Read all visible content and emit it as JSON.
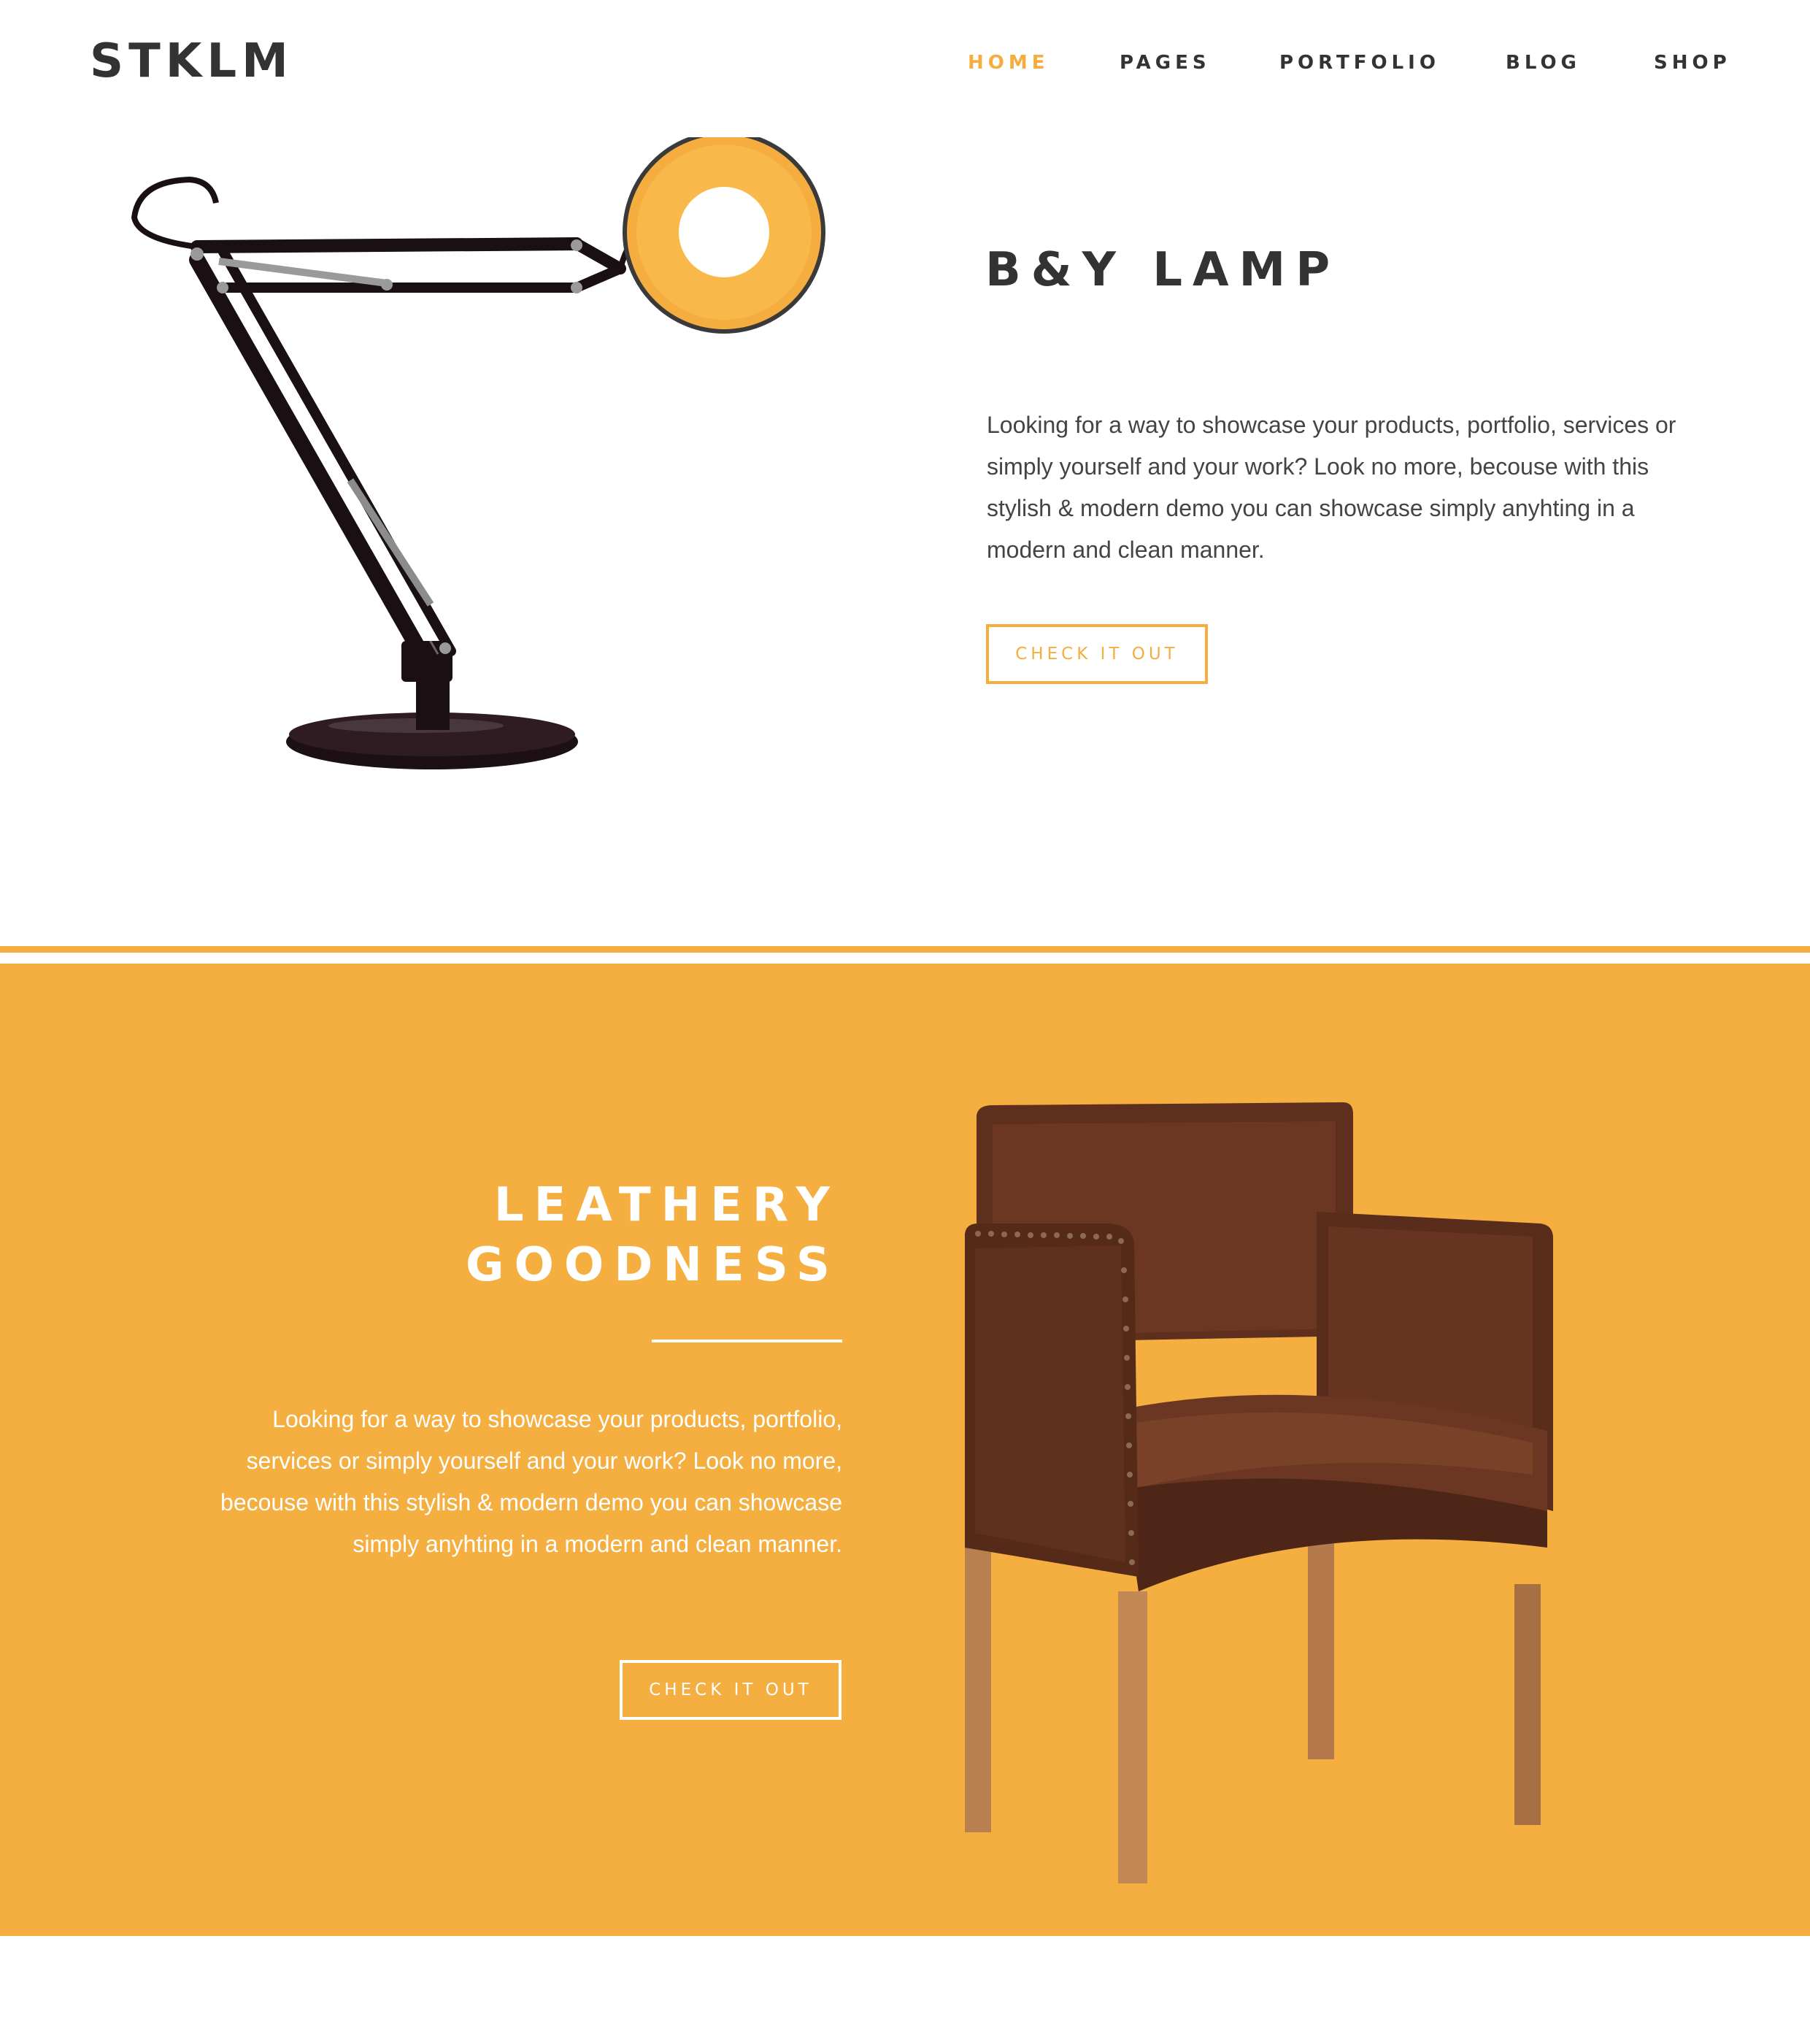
{
  "brand": {
    "logo": "STKLM",
    "accent_color": "#f5ad40"
  },
  "nav": {
    "items": [
      {
        "label": "HOME",
        "active": true
      },
      {
        "label": "PAGES",
        "active": false
      },
      {
        "label": "PORTFOLIO",
        "active": false
      },
      {
        "label": "BLOG",
        "active": false
      },
      {
        "label": "SHOP",
        "active": false
      }
    ]
  },
  "feature1": {
    "title": "B&Y LAMP",
    "description": "Looking for a way to showcase your products, portfolio, services or simply yourself and your work? Look no more, becouse with this stylish & modern demo you can showcase simply anyhting in a modern and clean manner.",
    "cta": "CHECK IT OUT",
    "image_icon": "desk-lamp-image"
  },
  "feature2": {
    "title_line1": "LEATHERY",
    "title_line2": "GOODNESS",
    "description": "Looking for a way to showcase your products, portfolio, services or simply yourself and your work? Look no more, becouse with this stylish & modern demo you can showcase simply anyhting in a modern and clean manner.",
    "cta": "CHECK IT OUT",
    "background_color": "#f5ae40",
    "image_icon": "leather-armchair-image"
  }
}
